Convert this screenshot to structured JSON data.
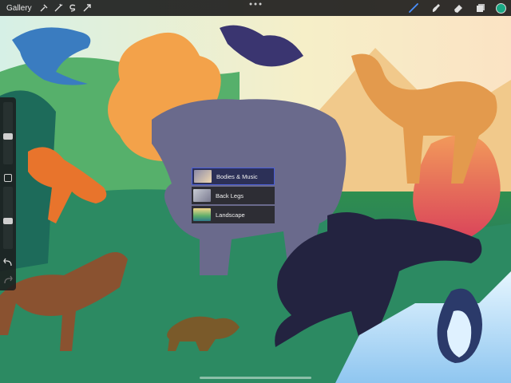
{
  "toolbar": {
    "gallery_label": "Gallery",
    "left_tools": [
      {
        "name": "actions-icon"
      },
      {
        "name": "adjustments-icon"
      },
      {
        "name": "selection-icon"
      },
      {
        "name": "transform-icon"
      }
    ],
    "more_icon": "ellipsis-icon",
    "right_tools": [
      {
        "name": "brush-icon",
        "active": true
      },
      {
        "name": "smudge-icon"
      },
      {
        "name": "eraser-icon"
      },
      {
        "name": "layers-icon"
      }
    ],
    "current_color": "#1aa884"
  },
  "colors": {
    "accent_blue": "#4c5fd8",
    "active_tool": "#4a90ff"
  },
  "sidebar": {
    "brush_size_level": 0.45,
    "opacity_level": 0.45,
    "modify_icon": "square-icon",
    "undo_icon": "undo-icon",
    "redo_icon": "redo-icon"
  },
  "layers": [
    {
      "label": "Bodies & Music",
      "selected": true
    },
    {
      "label": "Back Legs",
      "selected": false
    },
    {
      "label": "Landscape",
      "selected": false
    }
  ]
}
